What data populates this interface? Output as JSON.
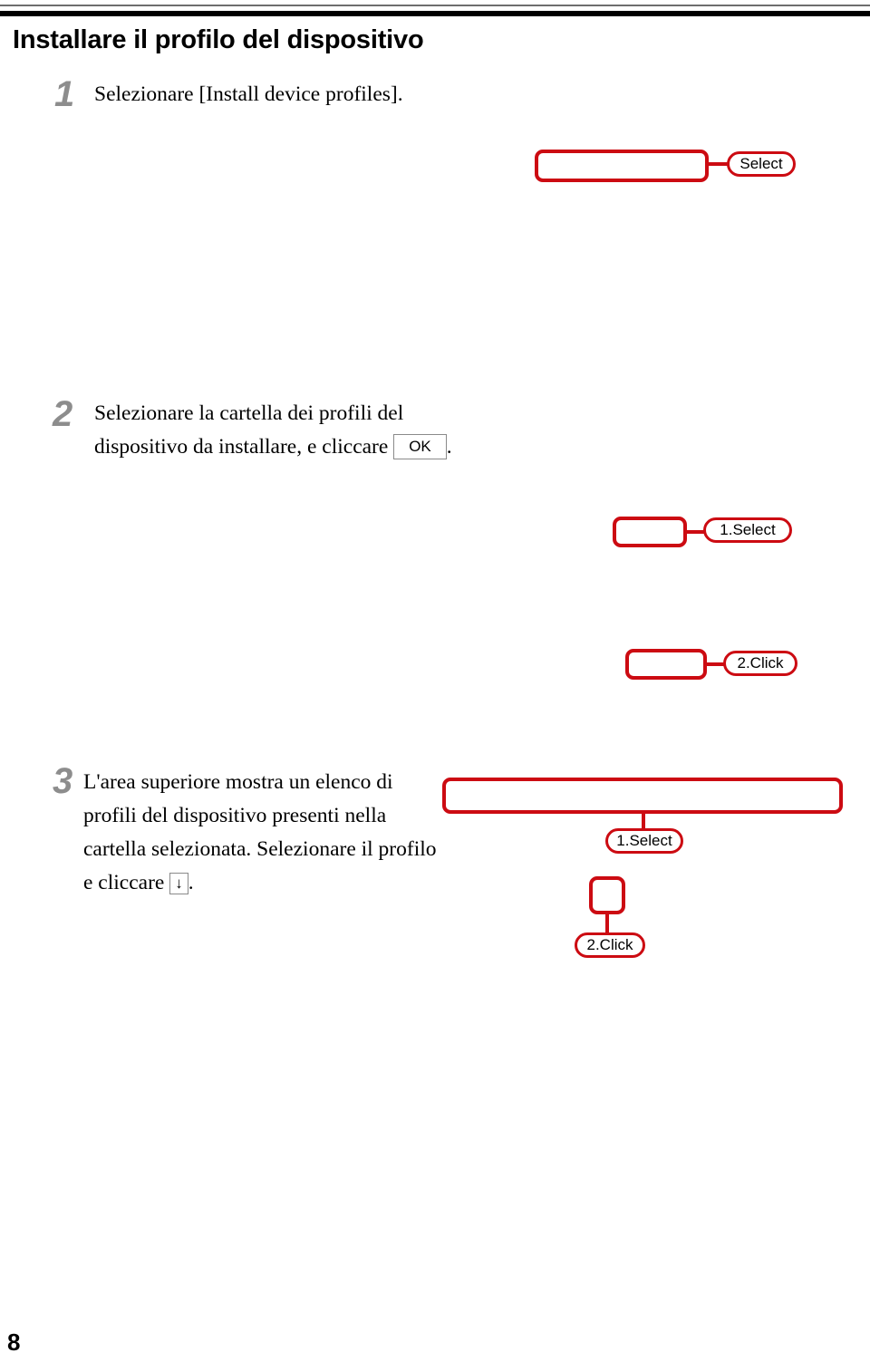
{
  "document": {
    "title": "Installare il profilo del dispositivo",
    "page_number": "8"
  },
  "steps": [
    {
      "number": "1",
      "text": "Selezionare [Install device profiles]."
    },
    {
      "number": "2",
      "text_before_key": "Selezionare la cartella dei profili del dispositivo da installare, e cliccare",
      "key_label": "OK",
      "text_after_key": "."
    },
    {
      "number": "3",
      "text_before_key": "L'area superiore mostra un elenco di profili  del dispositivo presenti nella cartella selezionata. Selezionare il profilo e cliccare",
      "key_label": "↓",
      "text_after_key": "."
    }
  ],
  "callouts": {
    "step1": {
      "label": "Select"
    },
    "step2": {
      "label_select": "1.Select",
      "label_click": "2.Click"
    },
    "step3": {
      "label_select": "1.Select",
      "label_click": "2.Click"
    }
  },
  "colors": {
    "callout_red": "#cc0b12",
    "step_number_gray": "#8d8d8d",
    "rule_gray": "#6e6e6e",
    "rule_black": "#000000"
  }
}
